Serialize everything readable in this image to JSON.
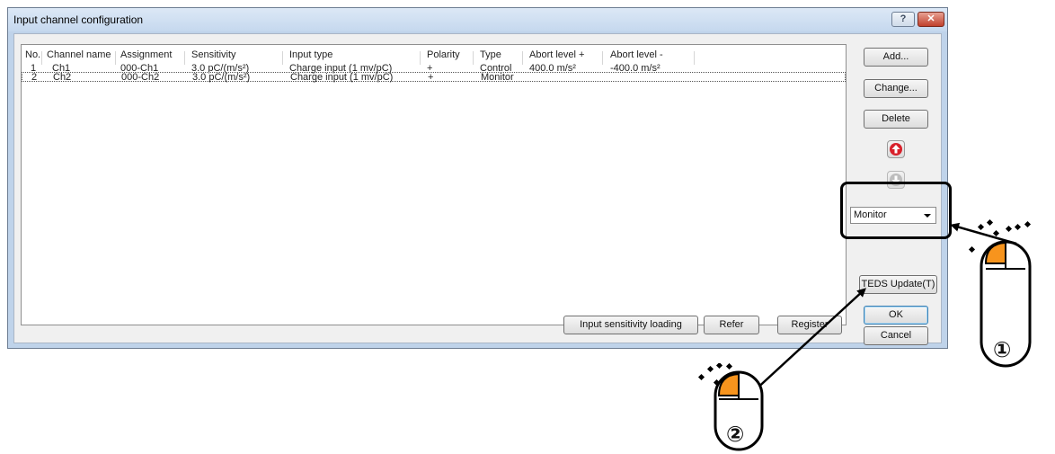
{
  "dialog": {
    "title": "Input channel configuration",
    "help_label": "?",
    "close_label": "✕"
  },
  "list": {
    "columns": [
      "No.",
      "Channel name",
      "Assignment",
      "Sensitivity",
      "Input type",
      "Polarity",
      "Type",
      "Abort level +",
      "Abort level -"
    ],
    "rows": [
      {
        "no": "1",
        "name": "Ch1",
        "assign": "000-Ch1",
        "sens": "3.0 pC/(m/s²)",
        "input": "Charge input (1 mv/pC)",
        "pol": "+",
        "type": "Control",
        "abort_p": "400.0 m/s²",
        "abort_m": "-400.0 m/s²"
      },
      {
        "no": "2",
        "name": "Ch2",
        "assign": "000-Ch2",
        "sens": "3.0 pC/(m/s²)",
        "input": "Charge input (1 mv/pC)",
        "pol": "+",
        "type": "Monitor",
        "abort_p": "",
        "abort_m": ""
      }
    ]
  },
  "buttons": {
    "add": "Add...",
    "change": "Change...",
    "delete": "Delete",
    "teds": "TEDS Update(T)",
    "ok": "OK",
    "cancel": "Cancel",
    "input_sens": "Input sensitivity loading",
    "refer": "Refer",
    "register": "Register"
  },
  "type_select": {
    "value": "Monitor"
  },
  "annotations": {
    "step1": "①",
    "step2": "②"
  },
  "colors": {
    "accent": "#f7941d",
    "up_arrow": "#d8202a"
  }
}
